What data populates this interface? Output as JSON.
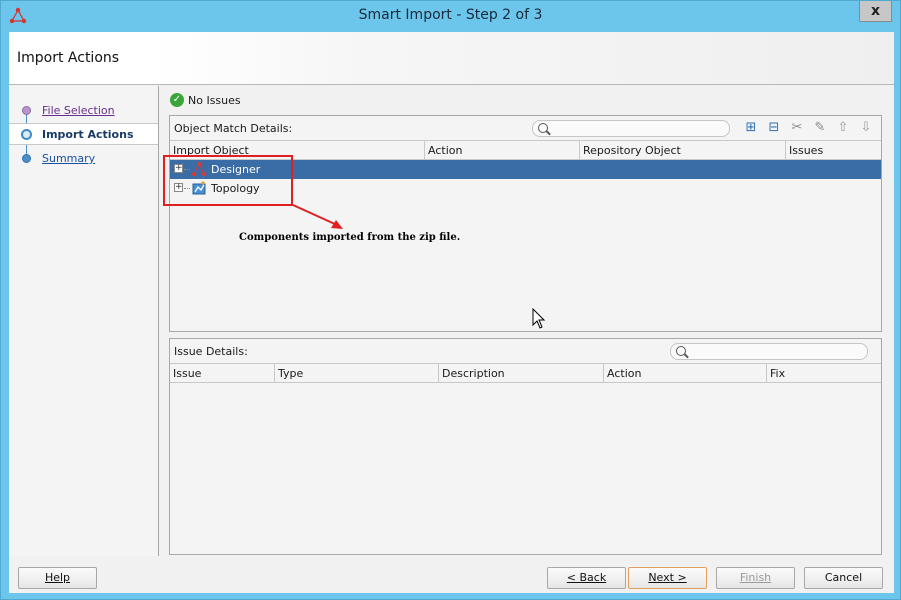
{
  "window": {
    "title": "Smart Import - Step 2 of 3",
    "close_label": "x"
  },
  "header": {
    "title": "Import Actions"
  },
  "nav": {
    "items": [
      {
        "label": "File Selection",
        "state": "visited"
      },
      {
        "label": "Import Actions",
        "state": "current"
      },
      {
        "label": "Summary",
        "state": "future"
      }
    ]
  },
  "status": {
    "icon": "check-circle-icon",
    "text": "No Issues"
  },
  "object_panel": {
    "title": "Object Match Details:",
    "search_placeholder": "",
    "columns": [
      "Import Object",
      "Action",
      "Repository Object",
      "Issues"
    ],
    "rows": [
      {
        "label": "Designer",
        "icon": "designer-icon",
        "selected": true
      },
      {
        "label": "Topology",
        "icon": "topology-icon",
        "selected": false
      }
    ],
    "toolbar": [
      "add-icon",
      "remove-icon",
      "cut-icon",
      "paste-icon",
      "move-up-icon",
      "move-down-icon"
    ]
  },
  "annotation": {
    "text": "Components imported from the zip file.",
    "color": "#e02020"
  },
  "issue_panel": {
    "title": "Issue Details:",
    "search_placeholder": "",
    "columns": [
      "Issue",
      "Type",
      "Description",
      "Action",
      "Fix"
    ]
  },
  "footer": {
    "help": "Help",
    "back": "< Back",
    "next": "Next >",
    "finish": "Finish",
    "cancel": "Cancel"
  },
  "colors": {
    "titlebar": "#6cc5ea",
    "selected_row": "#3a6da6",
    "accent": "#3d8bc9"
  }
}
